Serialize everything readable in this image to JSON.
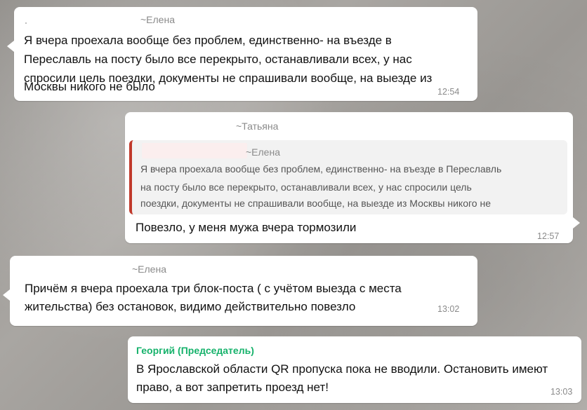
{
  "messages": [
    {
      "sender": "~Елена",
      "lines": [
        "Я вчера проехала вообще без проблем, единственно- на въезде в",
        "Переславль на посту было все перекрыто, останавливали всех, у нас",
        "спросили цель поездки, документы не спрашивали вообще, на выезде из",
        "Москвы никого не было"
      ],
      "time": "12:54"
    },
    {
      "sender": "~Татьяна",
      "quote": {
        "sender": "~Елена",
        "lines": [
          "Я вчера проехала вообще без проблем, единственно- на въезде в Переславль",
          "на посту было все перекрыто, останавливали всех, у нас спросили цель",
          "поездки, документы не спрашивали вообще, на выезде из Москвы никого не"
        ]
      },
      "lines": [
        "Повезло, у меня мужа вчера тормозили"
      ],
      "time": "12:57"
    },
    {
      "sender": "~Елена",
      "lines": [
        "Причём я вчера проехала три блок-поста ( с учётом выезда с места",
        "жительства) без остановок, видимо действительно повезло"
      ],
      "time": "13:02"
    },
    {
      "sender": "Георгий (Председатель)",
      "lines": [
        "В Ярославской области QR пропуска  пока не вводили. Остановить имеют",
        "право, а вот запретить проезд  нет!"
      ],
      "time": "13:03"
    }
  ],
  "colors": {
    "admin_name": "#16b26b",
    "quote_bar": "#c0392b"
  }
}
